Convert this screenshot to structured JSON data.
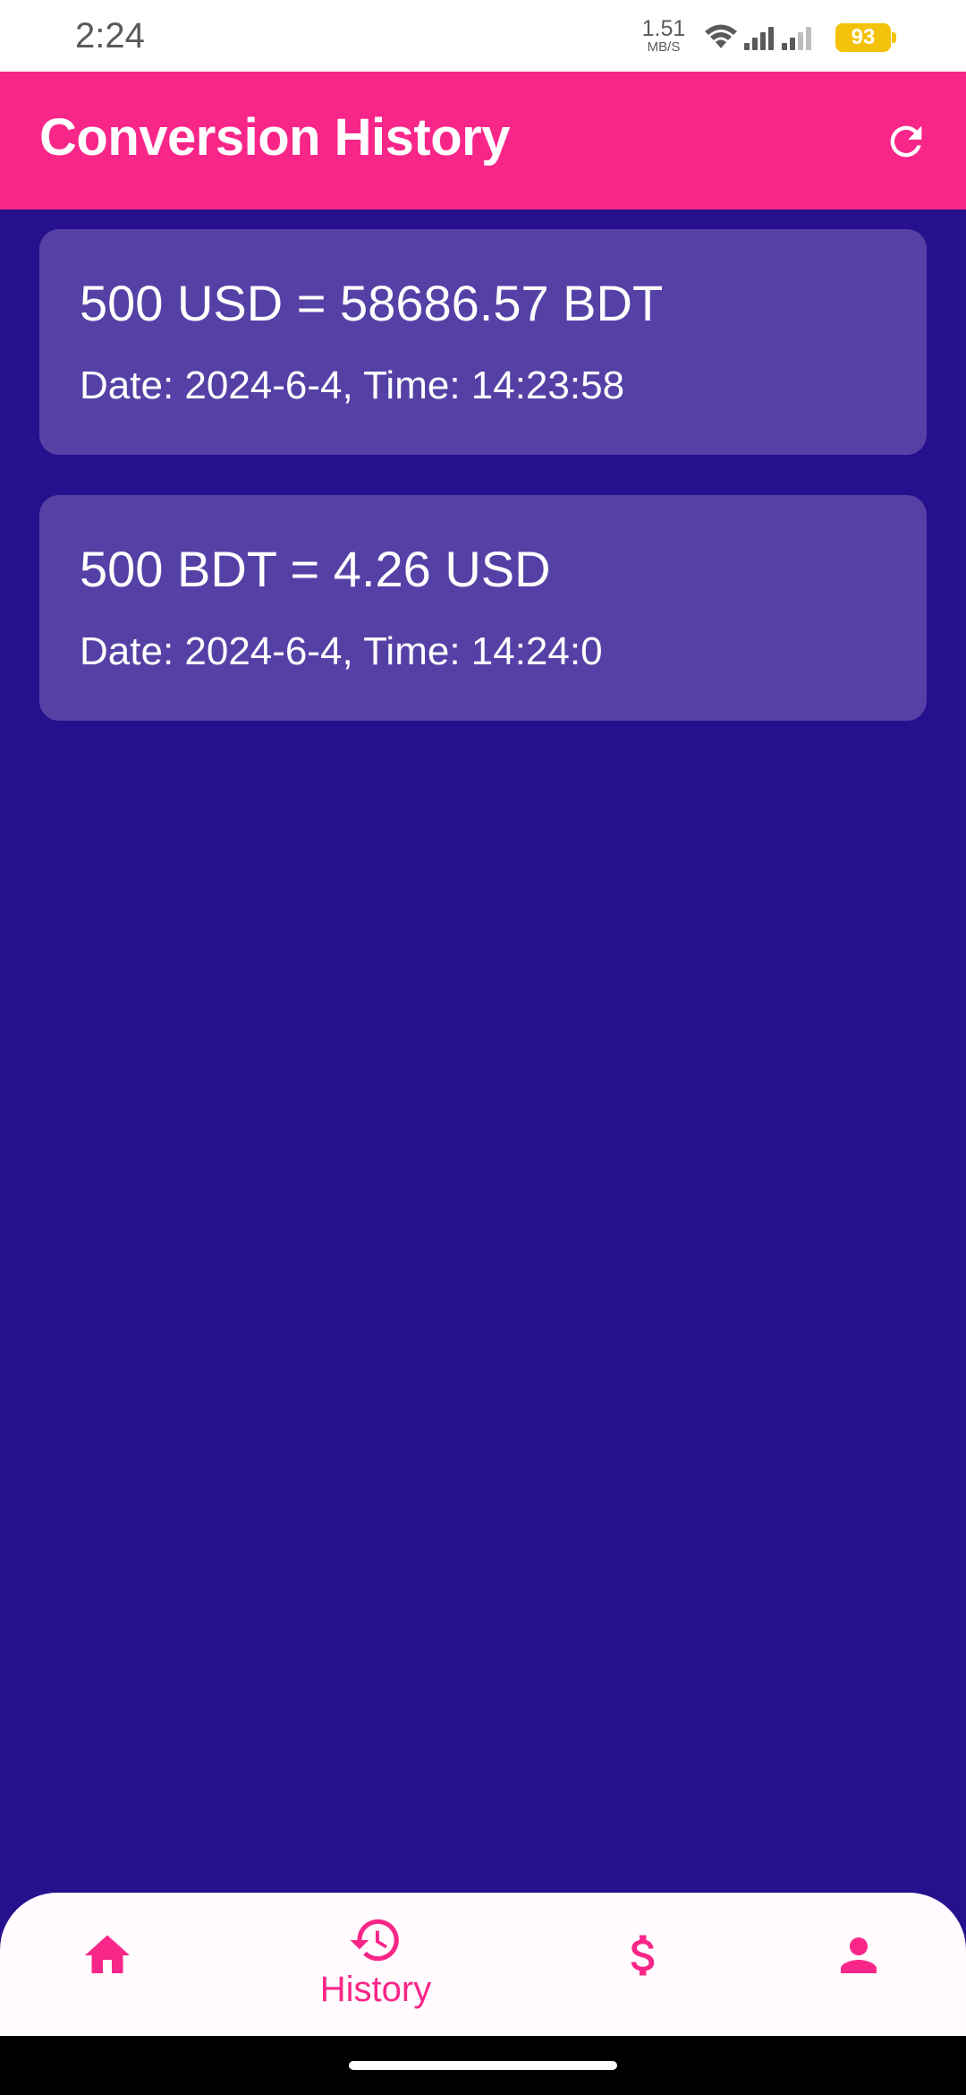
{
  "status_bar": {
    "time": "2:24",
    "net_speed_value": "1.51",
    "net_speed_unit": "MB/S",
    "battery_level": "93",
    "icons": [
      "wifi-icon",
      "signal-icon",
      "signal-icon",
      "battery-icon"
    ]
  },
  "app_bar": {
    "title": "Conversion History",
    "action_icon": "refresh-icon",
    "background": "#f92689"
  },
  "history": [
    {
      "conversion": "500 USD = 58686.57 BDT",
      "datetime": "Date: 2024-6-4, Time: 14:23:58"
    },
    {
      "conversion": "500 BDT = 4.26 USD",
      "datetime": "Date: 2024-6-4, Time: 14:24:0"
    }
  ],
  "bottom_nav": {
    "items": [
      {
        "icon": "home-icon",
        "label": ""
      },
      {
        "icon": "history-icon",
        "label": "History",
        "selected": true
      },
      {
        "icon": "dollar-icon",
        "label": ""
      },
      {
        "icon": "person-icon",
        "label": ""
      }
    ],
    "accent": "#f92689"
  },
  "colors": {
    "background": "#27108d",
    "card": "#5541a6"
  }
}
